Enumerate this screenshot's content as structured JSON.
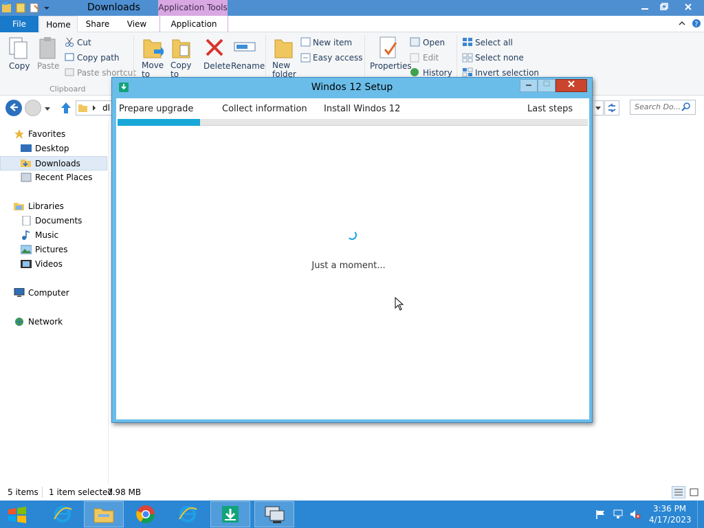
{
  "explorer": {
    "title": "Downloads",
    "contextual_tab_group": "Application Tools",
    "tabs": [
      "File",
      "Home",
      "Share",
      "View",
      "Application"
    ],
    "ribbon": {
      "clipboard": {
        "copy": "Copy",
        "paste": "Paste",
        "cut": "Cut",
        "copy_path": "Copy path",
        "paste_shortcut": "Paste shortcut",
        "label": "Clipboard"
      },
      "organize": {
        "move_to": "Move to",
        "copy_to": "Copy to",
        "delete": "Delete",
        "rename": "Rename"
      },
      "new": {
        "new_folder": "New folder",
        "new_item": "New item",
        "easy_access": "Easy access"
      },
      "open": {
        "properties": "Properties",
        "open": "Open",
        "edit": "Edit",
        "history": "History"
      },
      "select": {
        "select_all": "Select all",
        "select_none": "Select none",
        "invert_selection": "Invert selection"
      }
    },
    "address_fragment": "dl",
    "search_placeholder": "Search Do...",
    "nav": {
      "favorites": "Favorites",
      "desktop": "Desktop",
      "downloads": "Downloads",
      "recent_places": "Recent Places",
      "libraries": "Libraries",
      "documents": "Documents",
      "music": "Music",
      "pictures": "Pictures",
      "videos": "Videos",
      "computer": "Computer",
      "network": "Network"
    },
    "status": {
      "items": "5 items",
      "selected": "1 item selected",
      "size": "7.98 MB"
    }
  },
  "setup_dialog": {
    "title": "Windos 12 Setup",
    "steps": [
      "Prepare upgrade",
      "Collect information",
      "Install Windos 12",
      "Last steps"
    ],
    "progress": 0.175,
    "message": "Just a moment..."
  },
  "taskbar": {
    "time": "3:36 PM",
    "date": "4/17/2023"
  },
  "colors": {
    "titlebar": "#4e8fd1",
    "taskbar": "#2b87d3",
    "progress": "#18a8d8",
    "dialog_frame": "#6bbde9",
    "close_button": "#c9452e"
  }
}
